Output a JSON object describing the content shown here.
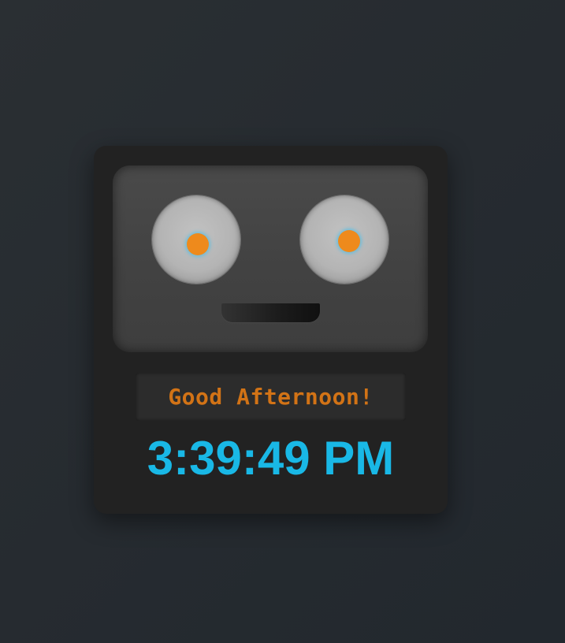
{
  "greeting": {
    "text": "Good Afternoon!"
  },
  "clock": {
    "time": "3:39:49 PM"
  },
  "colors": {
    "background": "#272d32",
    "card": "#222222",
    "face": "#464646",
    "eye": "#b8b8b8",
    "pupil": "#ee8a1c",
    "pupil_glow": "#50bee6",
    "greeting_text": "#d27316",
    "clock_text": "#19b8e6"
  }
}
